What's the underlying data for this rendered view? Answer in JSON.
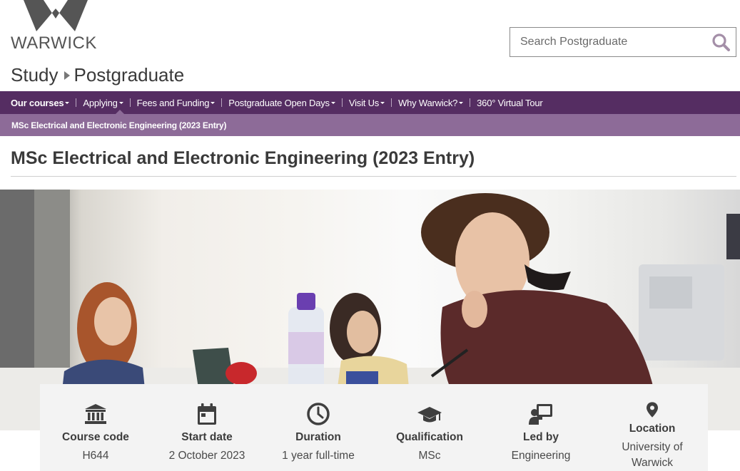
{
  "header": {
    "logo_text": "WARWICK",
    "search_placeholder": "Search Postgraduate",
    "site_section": "Study",
    "site_subsection": "Postgraduate"
  },
  "nav": {
    "items": [
      {
        "label": "Our courses",
        "has_dropdown": true,
        "active": true
      },
      {
        "label": "Applying",
        "has_dropdown": true
      },
      {
        "label": "Fees and Funding",
        "has_dropdown": true
      },
      {
        "label": "Postgraduate Open Days",
        "has_dropdown": true
      },
      {
        "label": "Visit Us",
        "has_dropdown": true
      },
      {
        "label": "Why Warwick?",
        "has_dropdown": true
      },
      {
        "label": "360° Virtual Tour",
        "has_dropdown": false
      }
    ],
    "subnav_item": "MSc Electrical and Electronic Engineering (2023 Entry)"
  },
  "page": {
    "title": "MSc Electrical and Electronic Engineering (2023 Entry)"
  },
  "info": [
    {
      "icon": "bank-icon",
      "label": "Course code",
      "value": "H644"
    },
    {
      "icon": "calendar-icon",
      "label": "Start date",
      "value": "2 October 2023"
    },
    {
      "icon": "clock-icon",
      "label": "Duration",
      "value": "1 year full-time"
    },
    {
      "icon": "graduation-cap-icon",
      "label": "Qualification",
      "value": "MSc"
    },
    {
      "icon": "presenter-icon",
      "label": "Led by",
      "value": "Engineering"
    },
    {
      "icon": "map-pin-icon",
      "label": "Location",
      "value": "University of Warwick"
    }
  ],
  "colors": {
    "nav_bg": "#552d62",
    "subnav_bg": "#8d6b98",
    "text": "#3a3a3a"
  }
}
